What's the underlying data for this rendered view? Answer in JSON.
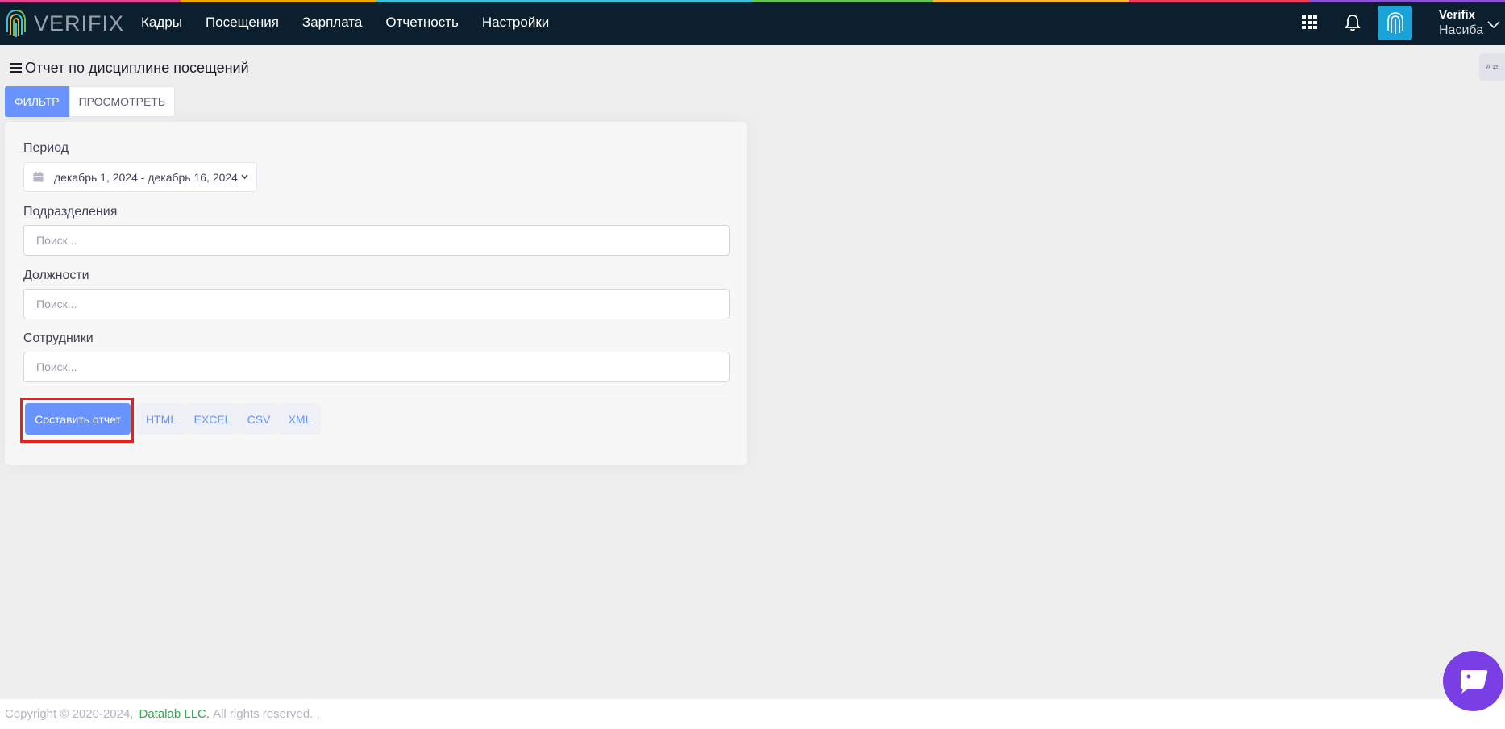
{
  "colors": {
    "navbar": "#0b1f2e",
    "primary": "#6993ff",
    "highlight": "#ee1c1c",
    "chat": "#7a3fe4",
    "footer_link": "#33a852"
  },
  "brand": {
    "logo_text": "VERIFIX"
  },
  "nav": {
    "items": [
      "Кадры",
      "Посещения",
      "Зарплата",
      "Отчетность",
      "Настройки"
    ]
  },
  "user": {
    "company": "Verifix",
    "name": "Насиба"
  },
  "page": {
    "title": "Отчет по дисциплине посещений",
    "side_tab": "A ⇄"
  },
  "tabs": {
    "filter": "ФИЛЬТР",
    "view": "ПРОСМОТРЕТЬ"
  },
  "form": {
    "period_label": "Период",
    "period_value": "декабрь 1, 2024 - декабрь 16, 2024",
    "divisions_label": "Подразделения",
    "positions_label": "Должности",
    "employees_label": "Сотрудники",
    "search_placeholder": "Поиск..."
  },
  "actions": {
    "build_report": "Составить отчет",
    "html": "HTML",
    "excel": "EXCEL",
    "csv": "CSV",
    "xml": "XML"
  },
  "footer": {
    "copyright": "Copyright © 2020-2024,",
    "company": "Datalab LLC.",
    "rights": "All rights reserved. ,"
  }
}
